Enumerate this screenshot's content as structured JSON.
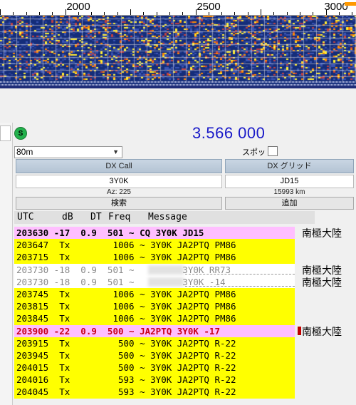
{
  "waterfall": {
    "scale_labels": [
      "2000",
      "2500",
      "3000"
    ]
  },
  "status": {
    "indicator": "S",
    "frequency": "3.566 000"
  },
  "band": {
    "selected": "80m",
    "spot_label": "スポット"
  },
  "dx": {
    "call_header": "DX Call",
    "grid_header": "DX グリッド",
    "call_value": "3Y0K",
    "grid_value": "JD15",
    "azimuth": "Az: 225",
    "distance": "15993 km",
    "search_button": "検索",
    "add_button": "追加"
  },
  "list": {
    "headers": [
      "UTC",
      "dB",
      "DT",
      "Freq",
      "Message"
    ],
    "rows": [
      {
        "style": "cq",
        "text": "203630 -17  0.9  501 ~ CQ 3Y0K JD15",
        "region": "南極大陸"
      },
      {
        "style": "tx",
        "text": "203647  Tx        1006 ~ 3Y0K JA2PTQ PM86",
        "region": ""
      },
      {
        "style": "tx",
        "text": "203715  Tx        1006 ~ 3Y0K JA2PTQ PM86",
        "region": ""
      },
      {
        "style": "old",
        "text": "203730 -18  0.9  501 ~         3Y0K RR73",
        "region": "南極大陸"
      },
      {
        "style": "old",
        "text": "203730 -18  0.9  501 ~         3Y0K -14",
        "region": "南極大陸"
      },
      {
        "style": "tx",
        "text": "203745  Tx        1006 ~ 3Y0K JA2PTQ PM86",
        "region": ""
      },
      {
        "style": "tx",
        "text": "203815  Tx        1006 ~ 3Y0K JA2PTQ PM86",
        "region": ""
      },
      {
        "style": "tx",
        "text": "203845  Tx        1006 ~ 3Y0K JA2PTQ PM86",
        "region": ""
      },
      {
        "style": "hl",
        "text": "203900 -22  0.9  500 ~ JA2PTQ 3Y0K -17",
        "region": "南極大陸"
      },
      {
        "style": "tx",
        "text": "203915  Tx         500 ~ 3Y0K JA2PTQ R-22",
        "region": ""
      },
      {
        "style": "tx",
        "text": "203945  Tx         500 ~ 3Y0K JA2PTQ R-22",
        "region": ""
      },
      {
        "style": "tx",
        "text": "204015  Tx         500 ~ 3Y0K JA2PTQ R-22",
        "region": ""
      },
      {
        "style": "tx",
        "text": "204016  Tx         593 ~ 3Y0K JA2PTQ R-22",
        "region": ""
      },
      {
        "style": "tx",
        "text": "204045  Tx         593 ~ 3Y0K JA2PTQ R-22",
        "region": ""
      }
    ]
  },
  "colors": {
    "frequency": "#1818c8",
    "tx_row": "#ffff00",
    "cq_row": "#ffbfff",
    "highlight_text": "#c8001c",
    "waterfall_bg": "#142d7a"
  }
}
